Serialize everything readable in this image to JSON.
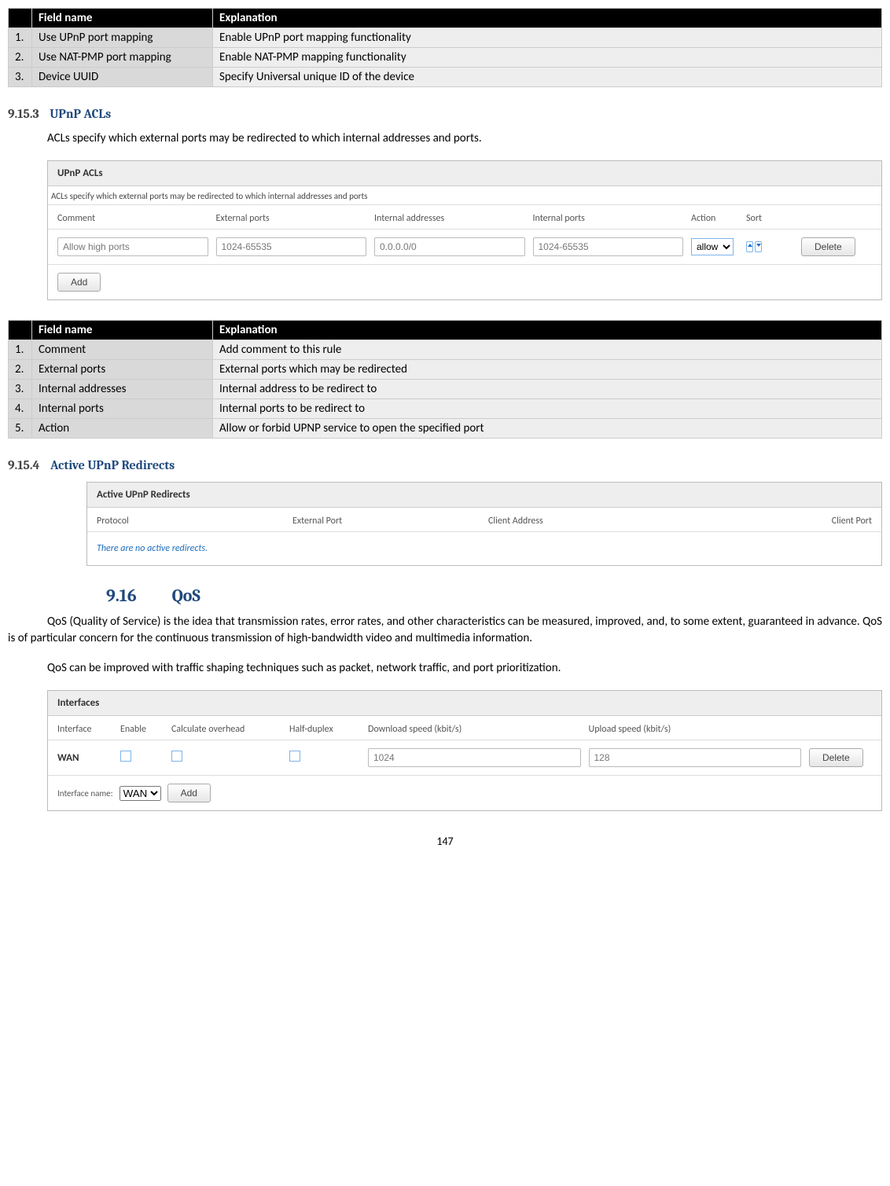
{
  "table1": {
    "headers": [
      "",
      "Field name",
      "Explanation"
    ],
    "rows": [
      {
        "n": "1.",
        "field": "Use UPnP port mapping",
        "expl": "Enable UPnP port mapping functionality"
      },
      {
        "n": "2.",
        "field": "Use NAT-PMP port mapping",
        "expl": "Enable NAT-PMP mapping functionality"
      },
      {
        "n": "3.",
        "field": "Device UUID",
        "expl": "Specify Universal unique ID of the device"
      }
    ]
  },
  "section_9_15_3": {
    "num": "9.15.3",
    "title": "UPnP ACLs",
    "desc": "ACLs specify which external ports may be redirected to which internal addresses and ports."
  },
  "upnp_panel": {
    "title": "UPnP ACLs",
    "desc": "ACLs specify which external ports may be redirected to which internal addresses and ports",
    "cols": [
      "Comment",
      "External ports",
      "Internal addresses",
      "Internal ports",
      "Action",
      "Sort",
      ""
    ],
    "row": {
      "comment": "Allow high ports",
      "ext": "1024-65535",
      "int_addr": "0.0.0.0/0",
      "int_ports": "1024-65535",
      "action": "allow",
      "delete": "Delete"
    },
    "add": "Add"
  },
  "table2": {
    "headers": [
      "",
      "Field name",
      "Explanation"
    ],
    "rows": [
      {
        "n": "1.",
        "field": "Comment",
        "expl": "Add comment to this rule"
      },
      {
        "n": "2.",
        "field": "External ports",
        "expl": "External ports which may be redirected"
      },
      {
        "n": "3.",
        "field": "Internal addresses",
        "expl": "Internal address to be redirect to"
      },
      {
        "n": "4.",
        "field": "Internal ports",
        "expl": "Internal ports to be redirect to"
      },
      {
        "n": "5.",
        "field": "Action",
        "expl": "Allow or forbid UPNP service to open the specified port"
      }
    ]
  },
  "section_9_15_4": {
    "num": "9.15.4",
    "title": "Active UPnP Redirects"
  },
  "active_panel": {
    "title": "Active UPnP Redirects",
    "cols": [
      "Protocol",
      "External Port",
      "Client Address",
      "Client Port"
    ],
    "empty": "There are no active redirects."
  },
  "section_9_16": {
    "num": "9.16",
    "title": "QoS",
    "p1": "QoS (Quality of Service) is the idea that transmission rates, error rates, and other characteristics can be measured, improved, and, to some extent, guaranteed in advance. QoS is of particular concern for the continuous transmission of high-bandwidth video and multimedia information.",
    "p2": "QoS can be improved with traffic shaping techniques such as packet, network traffic, and port prioritization."
  },
  "if_panel": {
    "title": "Interfaces",
    "cols": [
      "Interface",
      "Enable",
      "Calculate overhead",
      "Half-duplex",
      "Download speed (kbit/s)",
      "Upload speed (kbit/s)",
      ""
    ],
    "row": {
      "iface": "WAN",
      "dl": "1024",
      "ul": "128",
      "delete": "Delete"
    },
    "footer_label": "Interface name:",
    "footer_select": "WAN",
    "add": "Add"
  },
  "page": "147"
}
